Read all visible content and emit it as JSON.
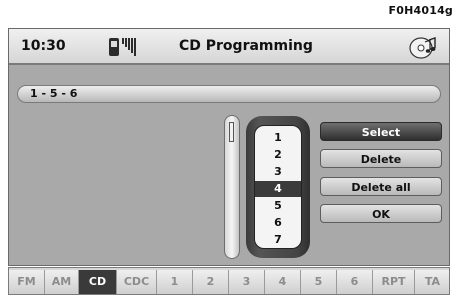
{
  "figure_ref": "F0H4014g",
  "header": {
    "time": "10:30",
    "title": "CD Programming",
    "phone_icon": "phone-signal-icon",
    "cd_icon": "cd-icon"
  },
  "sequence": "1 - 5 - 6",
  "picker": {
    "items": [
      "1",
      "2",
      "3",
      "4",
      "5",
      "6",
      "7"
    ],
    "selected": "4"
  },
  "buttons": [
    "Select",
    "Delete",
    "Delete all",
    "OK"
  ],
  "tabs": [
    "FM",
    "AM",
    "CD",
    "CDC",
    "1",
    "2",
    "3",
    "4",
    "5",
    "6",
    "RPT",
    "TA"
  ],
  "active_tab": "CD",
  "colors": {
    "screen_bg": "#a9a9a9",
    "header_bg": "#e6e6e6",
    "selected_bg": "#3b3b3b"
  }
}
